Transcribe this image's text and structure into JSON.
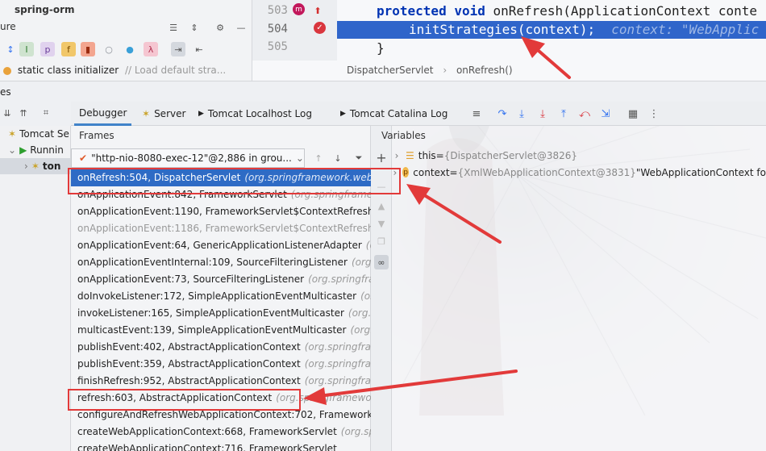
{
  "project": {
    "title": "spring-orm",
    "structure_label": "ure",
    "struct_item": "static class initializer",
    "struct_comment": "// Load default stra..."
  },
  "editor": {
    "lines": [
      {
        "num": "503",
        "code_kw": "protected void",
        "code_rest": " onRefresh(ApplicationContext conte"
      },
      {
        "num": "504",
        "code": "initStrategies(context);",
        "hint": "context: \"WebApplic"
      },
      {
        "num": "505",
        "code": "}"
      }
    ],
    "breadcrumb": [
      "DispatcherServlet",
      "onRefresh()"
    ]
  },
  "services_label": "es",
  "tabs": {
    "debugger": "Debugger",
    "server": "Server",
    "localhost_log": "Tomcat Localhost Log",
    "catalina_log": "Tomcat Catalina Log"
  },
  "tree": {
    "tomcat": "Tomcat Se",
    "running": "Runnin",
    "ton": "ton"
  },
  "frames": {
    "title": "Frames",
    "thread": "\"http-nio-8080-exec-12\"@2,886 in grou...",
    "items": [
      {
        "m": "onRefresh:504, DispatcherServlet",
        "p": "(org.springframework.web.se"
      },
      {
        "m": "onApplicationEvent:842, FrameworkServlet",
        "p": "(org.springframewo"
      },
      {
        "m": "onApplicationEvent:1190, FrameworkServlet$ContextRefreshListe",
        "p": ""
      },
      {
        "m": "onApplicationEvent:1186, FrameworkServlet$ContextRefreshListe",
        "p": ""
      },
      {
        "m": "onApplicationEvent:64, GenericApplicationListenerAdapter",
        "p": "(org"
      },
      {
        "m": "onApplicationEventInternal:109, SourceFilteringListener",
        "p": "(org.sp"
      },
      {
        "m": "onApplicationEvent:73, SourceFilteringListener",
        "p": "(org.springfram"
      },
      {
        "m": "doInvokeListener:172, SimpleApplicationEventMulticaster",
        "p": "(org."
      },
      {
        "m": "invokeListener:165, SimpleApplicationEventMulticaster",
        "p": "(org.sp"
      },
      {
        "m": "multicastEvent:139, SimpleApplicationEventMulticaster",
        "p": "(org.spr"
      },
      {
        "m": "publishEvent:402, AbstractApplicationContext",
        "p": "(org.springframe"
      },
      {
        "m": "publishEvent:359, AbstractApplicationContext",
        "p": "(org.springframe"
      },
      {
        "m": "finishRefresh:952, AbstractApplicationContext",
        "p": "(org.springframe"
      },
      {
        "m": "refresh:603, AbstractApplicationContext",
        "p": "(org.springframework.c"
      },
      {
        "m": "configureAndRefreshWebApplicationContext:702, FrameworkSe",
        "p": ""
      },
      {
        "m": "createWebApplicationContext:668, FrameworkServlet",
        "p": "(org.sprin"
      },
      {
        "m": "createWebApplicationContext:716, FrameworkServlet",
        "p": ""
      }
    ]
  },
  "variables": {
    "title": "Variables",
    "items": [
      {
        "name": "this",
        "eq": " = ",
        "val": "{DispatcherServlet@3826}",
        "extra": ""
      },
      {
        "name": "context",
        "eq": " = ",
        "val": "{XmlWebApplicationContext@3831}",
        "extra": " \"WebApplicationContext fo"
      }
    ]
  },
  "colors": {
    "accent": "#2f65ca",
    "annotation": "#e23a3a"
  }
}
